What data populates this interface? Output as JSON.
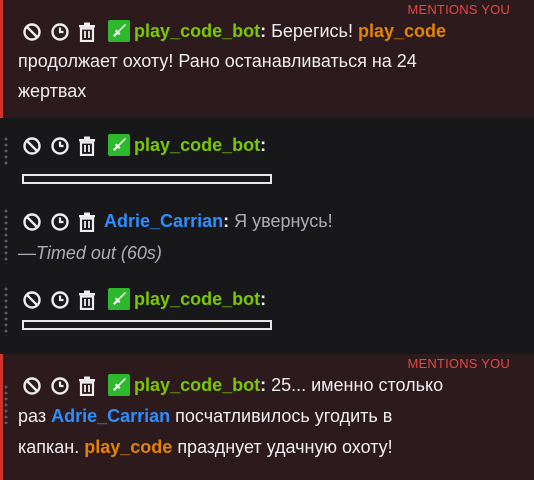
{
  "mention_label": "MENTIONS YOU",
  "icons": [
    "ban-icon",
    "clock-icon",
    "trash-icon",
    "sword-badge-icon"
  ],
  "messages": [
    {
      "author": "play_code_bot",
      "colon": ":",
      "text1": " Берегись! ",
      "mention_user": "play_code",
      "line2": "продолжает охоту! Рано останавливаться на 24",
      "line3": "жертвах"
    },
    {
      "author": "play_code_bot",
      "colon": ":"
    },
    {
      "author": "Adrie_Carrian",
      "colon": ":",
      "text": " Я увернусь!",
      "status": "—Timed out (60s)"
    },
    {
      "author": "play_code_bot",
      "colon": ":"
    },
    {
      "author": "play_code_bot",
      "colon": ":",
      "text1": " 25... именно столько",
      "line2_pre": "раз ",
      "line2_user": "Adrie_Carrian",
      "line2_post": " посчатливилось угодить в",
      "line3_pre": "капкан. ",
      "line3_user": "play_code",
      "line3_post": " празднует удачную охоту!"
    }
  ],
  "colors": {
    "mention_bg": "#2d1a1c",
    "mention_border": "#d2322d",
    "mention_tag": "#e94645",
    "bot_name": "#7ac800",
    "user_blue": "#2f8eff",
    "user_orange": "#e38400",
    "badge_green": "#2eb82e"
  }
}
